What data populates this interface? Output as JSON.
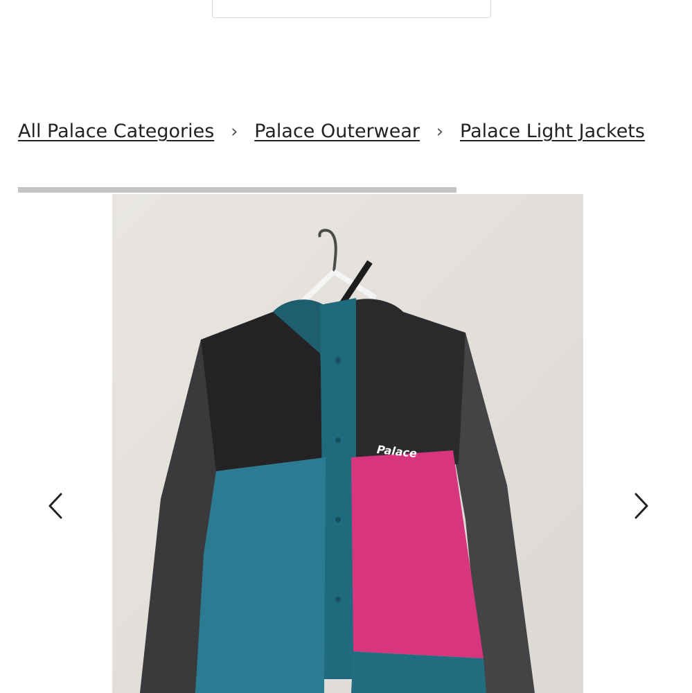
{
  "breadcrumb": {
    "items": [
      {
        "label": "All Palace Categories"
      },
      {
        "label": "Palace Outerwear"
      },
      {
        "label": "Palace Light Jackets"
      }
    ],
    "separator": "›"
  },
  "gallery": {
    "progress_fraction": 0.665,
    "photo_logo_text": "Palace",
    "prev_icon": "chevron-left-icon",
    "next_icon": "chevron-right-icon"
  }
}
